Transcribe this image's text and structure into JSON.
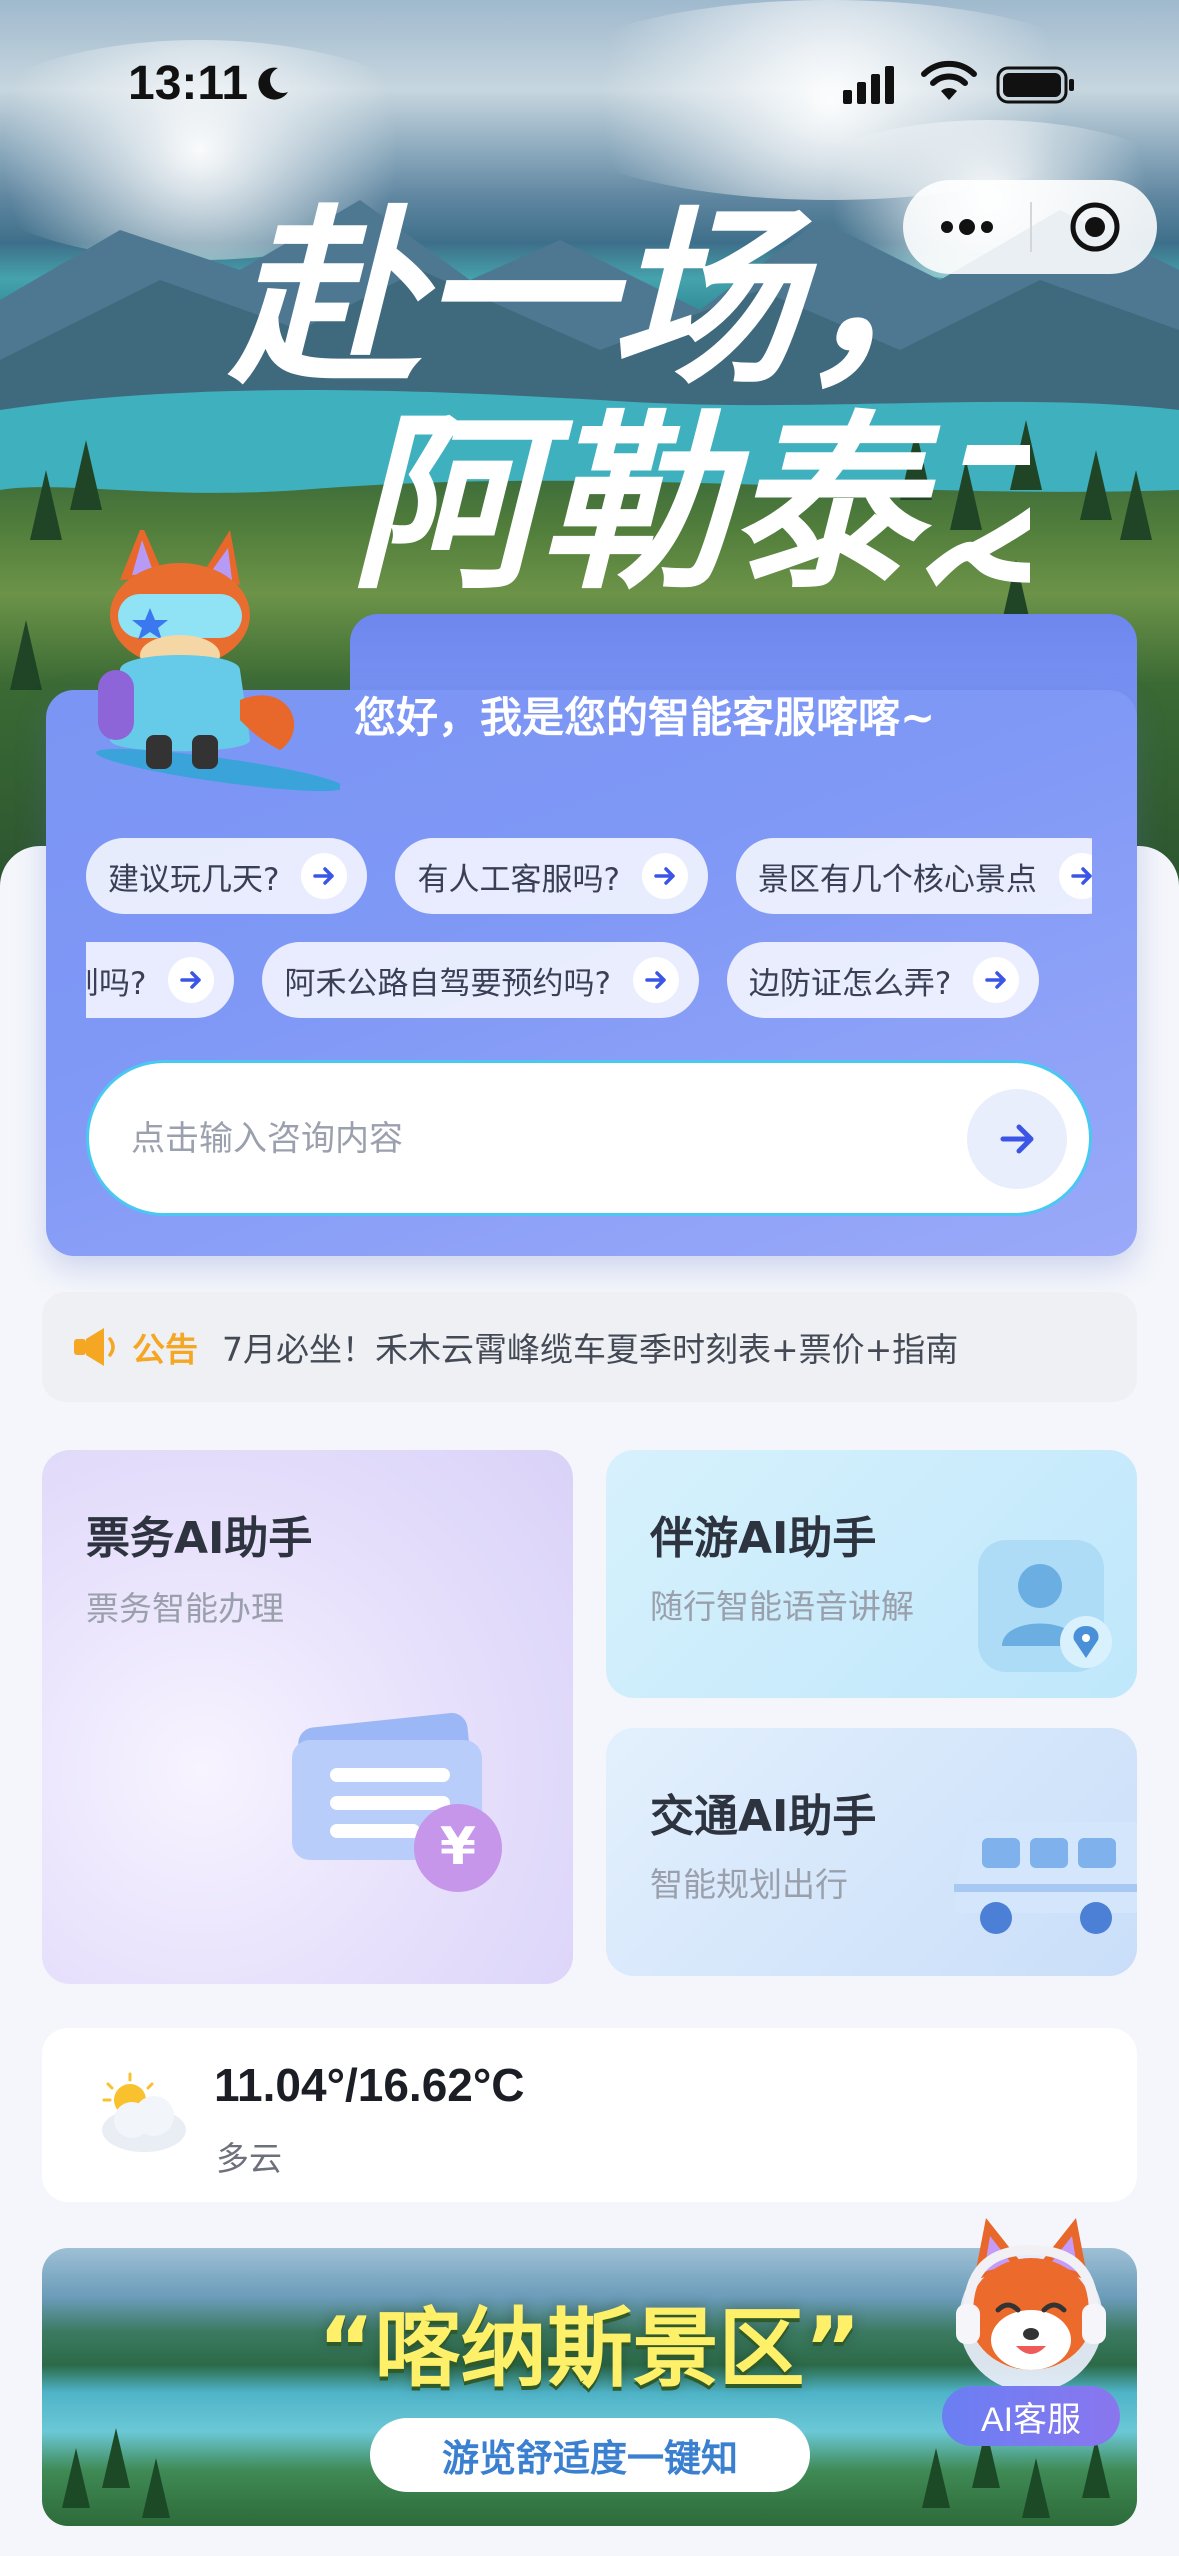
{
  "status_bar": {
    "time": "13:11",
    "icons": [
      "moon-icon",
      "signal-icon",
      "wifi-icon",
      "battery-icon"
    ]
  },
  "capsule": {
    "icons": [
      "more-dots-icon",
      "close-target-icon"
    ]
  },
  "hero": {
    "title_line1": "赴一场，",
    "title_line2": "阿勒泰之约"
  },
  "chat": {
    "greeting": "您好，我是您的智能客服喀喀~",
    "chips_row1": [
      "建议玩几天?",
      "有人工客服吗?",
      "景区有几个核心景点"
    ],
    "chips_row2": [
      "到吗?",
      "阿禾公路自驾要预约吗?",
      "边防证怎么弄?"
    ],
    "input_placeholder": "点击输入咨询内容"
  },
  "notice": {
    "tag": "公告",
    "text": "7月必坐！禾木云霄峰缆车夏季时刻表+票价+指南"
  },
  "assistants": {
    "ticket": {
      "title": "票务AI助手",
      "subtitle": "票务智能办理"
    },
    "guide": {
      "title": "伴游AI助手",
      "subtitle": "随行智能语音讲解"
    },
    "traffic": {
      "title": "交通AI助手",
      "subtitle": "智能规划出行"
    }
  },
  "weather": {
    "temp": "11.04°/16.62°C",
    "condition": "多云",
    "icon": "partly-cloudy-icon"
  },
  "banner": {
    "title": "“喀纳斯景区”",
    "subtitle": "游览舒适度一键知"
  },
  "ai_service": {
    "label": "AI客服"
  },
  "colors": {
    "accent_blue": "#7b95f4",
    "input_border": "#49c8f2",
    "notice_tag": "#f5a623",
    "banner_title": "#fff06a"
  }
}
